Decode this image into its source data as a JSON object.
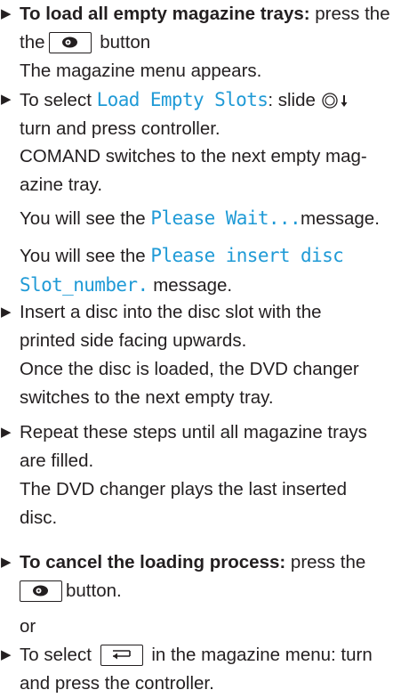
{
  "steps": [
    {
      "bold_lead": "To load all empty magazine trays:",
      "text_before_button": "press the",
      "button_icon": "disc-icon",
      "text_after_button": "button",
      "result": "The magazine menu appears."
    },
    {
      "text_before_item": "To select",
      "menu_item": "Load Empty Slots",
      "text_after_item": ": slide",
      "controller_icon": "controller-slide-down-icon",
      "text_after_icon": ", turn and press controller.",
      "result": "COMAND switches to the next empty mag-azine tray."
    }
  ],
  "messages": [
    {
      "prefix": "You will see the",
      "message": "Please Wait...",
      "suffix": "message."
    },
    {
      "prefix": "You will see the",
      "message_line1": "Please insert disc",
      "message_line2": "Slot_number.",
      "suffix": "message."
    }
  ],
  "steps_more": [
    {
      "text": "Insert a disc into the disc slot with the printed side facing upwards.",
      "result": "Once the disc is loaded, the DVD changer switches to the next empty tray."
    },
    {
      "text": "Repeat these steps until all magazine trays are filled.",
      "result": "The DVD changer plays the last inserted disc."
    }
  ],
  "cancel": {
    "bold_lead": "To cancel the loading process:",
    "text_before_button": "press the",
    "button_icon": "disc-icon",
    "text_after_button": "button.",
    "or": "or",
    "select_text_before": "To select",
    "back_icon": "back-arrow-icon",
    "select_text_after": "in the magazine menu: turn and press the controller."
  },
  "colors": {
    "text": "#231f20",
    "menu_text": "#1f9ad6"
  }
}
